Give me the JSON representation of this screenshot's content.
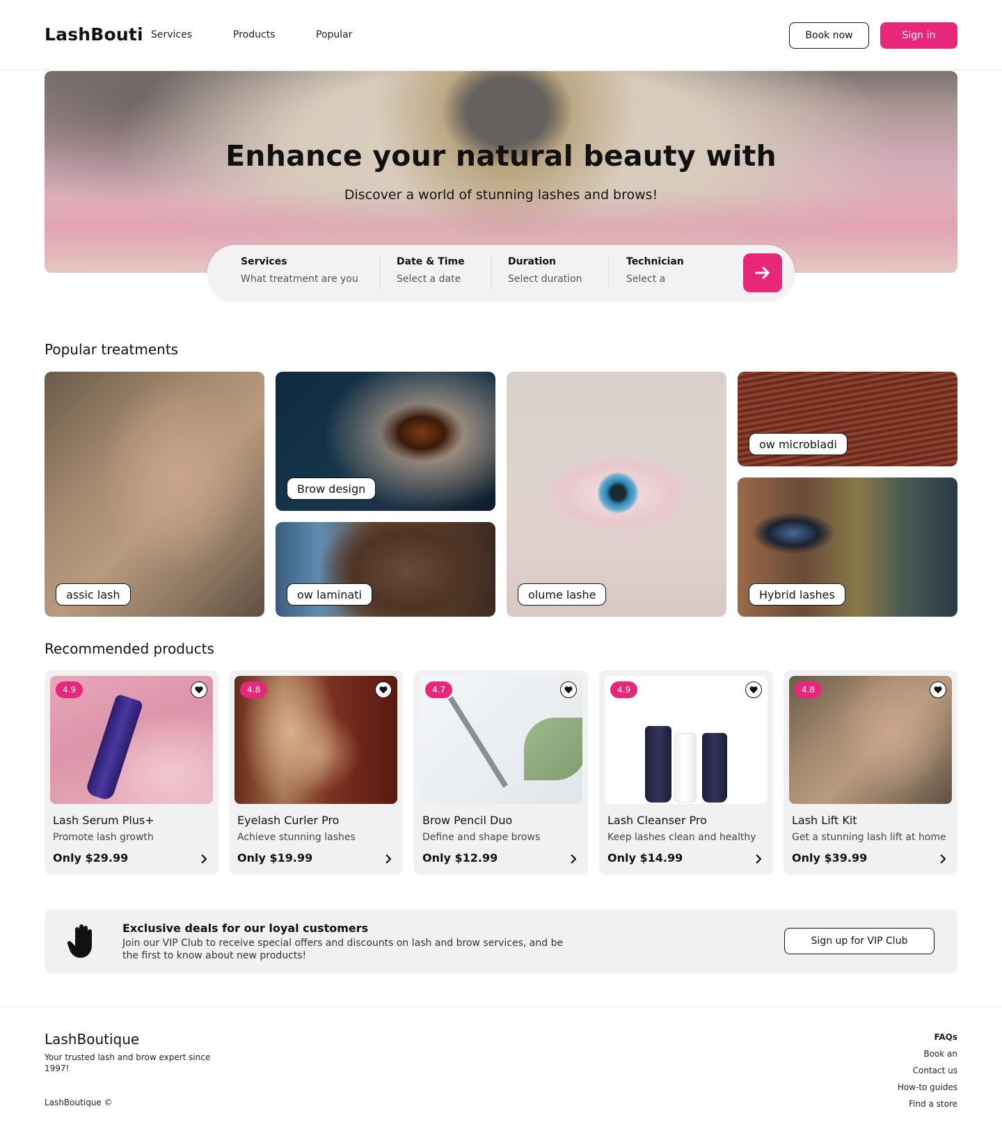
{
  "header": {
    "logo": "LashBouti",
    "nav": [
      "Services",
      "Products",
      "Popular"
    ],
    "book_label": "Book now",
    "signin_label": "Sign in"
  },
  "hero": {
    "title": "Enhance your natural beauty with",
    "subtitle": "Discover a world of stunning lashes and brows!"
  },
  "search": {
    "fields": [
      {
        "label": "Services",
        "value": "What treatment are you"
      },
      {
        "label": "Date & Time",
        "value": "Select a date"
      },
      {
        "label": "Duration",
        "value": "Select duration"
      },
      {
        "label": "Technician",
        "value": "Select a"
      }
    ],
    "go_icon": "arrow-right-icon"
  },
  "treatments": {
    "title": "Popular treatments",
    "items": [
      {
        "label": "assic lash"
      },
      {
        "label": "Brow design"
      },
      {
        "label": "ow laminati"
      },
      {
        "label": "olume lashe"
      },
      {
        "label": "ow microbladi"
      },
      {
        "label": "Hybrid lashes"
      }
    ]
  },
  "products": {
    "title": "Recommended products",
    "items": [
      {
        "rating": "4.9",
        "name": "Lash Serum Plus+",
        "desc": "Promote lash growth",
        "price": "Only $29.99"
      },
      {
        "rating": "4.8",
        "name": "Eyelash Curler Pro",
        "desc": "Achieve stunning lashes",
        "price": "Only $19.99"
      },
      {
        "rating": "4.7",
        "name": "Brow Pencil Duo",
        "desc": "Define and shape brows",
        "price": "Only $12.99"
      },
      {
        "rating": "4.9",
        "name": "Lash Cleanser Pro",
        "desc": "Keep lashes clean and healthy",
        "price": "Only $14.99"
      },
      {
        "rating": "4.8",
        "name": "Lash Lift Kit",
        "desc": "Get a stunning lash lift at home",
        "price": "Only $39.99"
      }
    ]
  },
  "vip": {
    "title": "Exclusive deals for our loyal customers",
    "text": "Join our VIP Club to receive special offers and discounts on lash and brow services, and be the first to know about new products!",
    "button": "Sign up for VIP Club",
    "icon": "hand-icon"
  },
  "footer": {
    "logo": "LashBoutique",
    "tagline": "Your trusted lash and brow expert since 1997!",
    "copyright": "LashBoutique ©",
    "links": [
      "FAQs",
      "Book an",
      "Contact us",
      "How-to guides",
      "Find a store"
    ]
  },
  "colors": {
    "accent": "#e8267a",
    "card_bg": "#f1f1f1"
  }
}
